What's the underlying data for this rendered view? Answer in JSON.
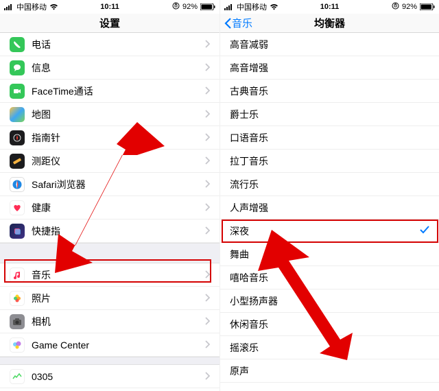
{
  "status": {
    "carrier": "中国移动",
    "time": "10:11",
    "battery": "92%"
  },
  "left": {
    "title": "设置",
    "items": [
      {
        "label": "电话"
      },
      {
        "label": "信息"
      },
      {
        "label": "FaceTime通话"
      },
      {
        "label": "地图"
      },
      {
        "label": "指南针"
      },
      {
        "label": "测距仪"
      },
      {
        "label": "Safari浏览器"
      },
      {
        "label": "健康"
      },
      {
        "label": "快捷指"
      },
      {
        "label": "音乐"
      },
      {
        "label": "照片"
      },
      {
        "label": "相机"
      },
      {
        "label": "Game Center"
      },
      {
        "label": "0305"
      }
    ]
  },
  "right": {
    "back": "音乐",
    "title": "均衡器",
    "items": [
      {
        "label": "高音减弱"
      },
      {
        "label": "高音增强"
      },
      {
        "label": "古典音乐"
      },
      {
        "label": "爵士乐"
      },
      {
        "label": "口语音乐"
      },
      {
        "label": "拉丁音乐"
      },
      {
        "label": "流行乐"
      },
      {
        "label": "人声增强"
      },
      {
        "label": "深夜",
        "selected": true
      },
      {
        "label": "舞曲"
      },
      {
        "label": "嘻哈音乐"
      },
      {
        "label": "小型扬声器"
      },
      {
        "label": "休闲音乐"
      },
      {
        "label": "摇滚乐"
      },
      {
        "label": "原声"
      }
    ]
  }
}
